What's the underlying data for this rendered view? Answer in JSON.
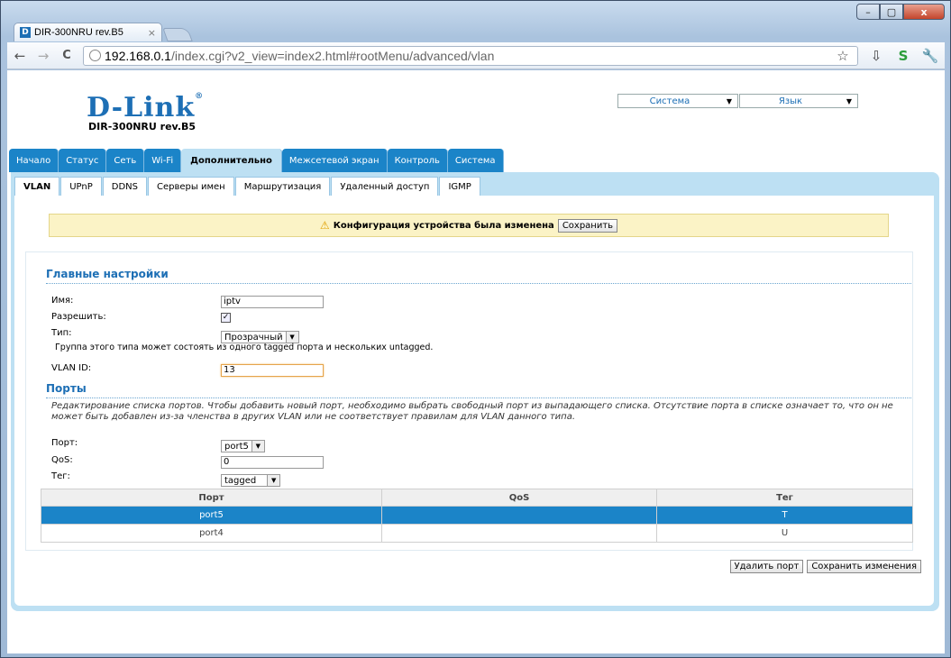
{
  "browser": {
    "tab_title": "DIR-300NRU rev.B5",
    "tab_favicon": "D",
    "tab_close": "×",
    "url_host": "192.168.0.1",
    "url_path": "/index.cgi?v2_view=index2.html#rootMenu/advanced/vlan",
    "back_icon": "←",
    "forward_icon": "→",
    "reload_icon": "C",
    "star_icon": "☆",
    "download_icon": "⇩",
    "extension_icon": "S",
    "wrench_icon": "🔧",
    "win_min": "–",
    "win_max": "▢",
    "win_close": "x"
  },
  "header": {
    "logo": "D-Link",
    "logo_reg": "®",
    "model": "DIR-300NRU rev.B5",
    "system_select": "Система",
    "language_select": "Язык",
    "dropdown_arrow": "▼"
  },
  "main_tabs": [
    "Начало",
    "Статус",
    "Сеть",
    "Wi-Fi",
    "Дополнительно",
    "Межсетевой экран",
    "Контроль",
    "Система"
  ],
  "sub_tabs": [
    "VLAN",
    "UPnP",
    "DDNS",
    "Серверы имен",
    "Маршрутизация",
    "Удаленный доступ",
    "IGMP"
  ],
  "notice": {
    "icon": "⚠",
    "text": "Конфигурация устройства была изменена",
    "save_button": "Сохранить"
  },
  "main_settings": {
    "title": "Главные настройки",
    "name_label": "Имя:",
    "name_value": "iptv",
    "enable_label": "Разрешить:",
    "enable_check": "✓",
    "type_label": "Тип:",
    "type_value": "Прозрачный",
    "type_hint": "Группа этого типа может состоять из одного tagged порта и нескольких untagged.",
    "vlan_id_label": "VLAN ID:",
    "vlan_id_value": "13"
  },
  "ports": {
    "title": "Порты",
    "description": "Редактирование списка портов. Чтобы добавить новый порт, необходимо выбрать свободный порт из выпадающего списка. Отсутствие порта в списке означает то, что он не может быть добавлен из-за членства в других VLAN или не соответствует правилам для VLAN данного типа.",
    "port_label": "Порт:",
    "port_value": "port5",
    "qos_label": "QoS:",
    "qos_value": "0",
    "tag_label": "Тег:",
    "tag_value": "tagged",
    "table_headers": [
      "Порт",
      "QoS",
      "Тег"
    ],
    "rows": [
      {
        "port": "port5",
        "qos": "",
        "tag": "T"
      },
      {
        "port": "port4",
        "qos": "",
        "tag": "U"
      }
    ]
  },
  "actions": {
    "delete_port": "Удалить порт",
    "save_changes": "Сохранить изменения"
  }
}
